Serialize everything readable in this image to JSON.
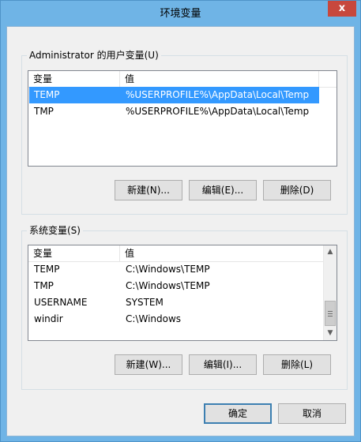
{
  "window": {
    "title": "环境变量",
    "close_glyph": "x"
  },
  "user_vars": {
    "legend": "Administrator 的用户变量(U)",
    "columns": [
      "变量",
      "值"
    ],
    "rows": [
      {
        "name": "TEMP",
        "value": "%USERPROFILE%\\AppData\\Local\\Temp",
        "selected": true
      },
      {
        "name": "TMP",
        "value": "%USERPROFILE%\\AppData\\Local\\Temp",
        "selected": false
      }
    ],
    "buttons": {
      "new": "新建(N)...",
      "edit": "编辑(E)...",
      "delete": "删除(D)"
    }
  },
  "system_vars": {
    "legend": "系统变量(S)",
    "columns": [
      "变量",
      "值"
    ],
    "rows": [
      {
        "name": "TEMP",
        "value": "C:\\Windows\\TEMP"
      },
      {
        "name": "TMP",
        "value": "C:\\Windows\\TEMP"
      },
      {
        "name": "USERNAME",
        "value": "SYSTEM"
      },
      {
        "name": "windir",
        "value": "C:\\Windows"
      }
    ],
    "buttons": {
      "new": "新建(W)...",
      "edit": "编辑(I)...",
      "delete": "删除(L)"
    }
  },
  "footer": {
    "ok": "确定",
    "cancel": "取消"
  },
  "colors": {
    "selection": "#3399ff",
    "frame": "#6fb4e6",
    "close": "#c7483d"
  }
}
